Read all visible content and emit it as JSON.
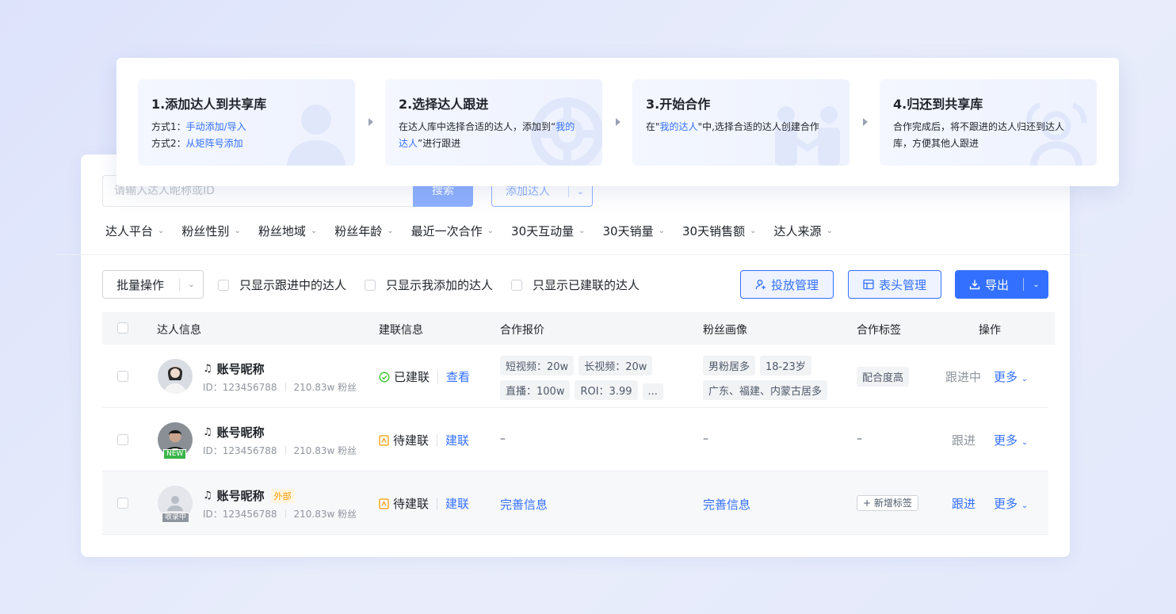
{
  "steps": [
    {
      "title": "1.添加达人到共享库",
      "line1_prefix": "方式1：",
      "line1_link": "手动添加/导入",
      "line2_prefix": "方式2：",
      "line2_link": "从矩阵号添加"
    },
    {
      "title": "2.选择达人跟进",
      "desc_a": "在达人库中选择合适的达人，添加到“",
      "desc_link": "我的达人",
      "desc_b": "”进行跟进"
    },
    {
      "title": "3.开始合作",
      "desc_a": "在\"",
      "desc_link": "我的达人",
      "desc_b": "\"中,选择合适的达人创建合作"
    },
    {
      "title": "4.归还到共享库",
      "desc": "合作完成后，将不跟进的达人归还到达人库，方便其他人跟进"
    }
  ],
  "search": {
    "placeholder": "请输入达人昵称或ID",
    "button": "搜索",
    "add_button": "添加达人"
  },
  "filters": [
    "达人平台",
    "粉丝性别",
    "粉丝地域",
    "粉丝年龄",
    "最近一次合作",
    "30天互动量",
    "30天销量",
    "30天销售额",
    "达人来源"
  ],
  "toolbar": {
    "batch": "批量操作",
    "check_following": "只显示跟进中的达人",
    "check_mine": "只显示我添加的达人",
    "check_linked": "只显示已建联的达人",
    "ad_manage": "投放管理",
    "header_manage": "表头管理",
    "export": "导出"
  },
  "columns": [
    "达人信息",
    "建联信息",
    "合作报价",
    "粉丝画像",
    "合作标签",
    "操作"
  ],
  "rows": [
    {
      "name": "账号昵称",
      "id": "ID：123456788",
      "fans": "210.83w 粉丝",
      "status": "已建联",
      "status_link": "查看",
      "quotes": [
        "短视频：20w",
        "长视频：20w",
        "直播：100w",
        "ROI：3.99",
        "..."
      ],
      "portrait": [
        "男粉居多",
        "18-23岁",
        "广东、福建、内蒙古居多"
      ],
      "tag": "配合度高",
      "action": "跟进中",
      "more": "更多"
    },
    {
      "name": "账号昵称",
      "id": "ID：123456788",
      "fans": "210.83w 粉丝",
      "badge": "NEW",
      "status": "待建联",
      "status_link": "建联",
      "quote_empty": "–",
      "portrait_empty": "–",
      "tag_empty": "–",
      "action": "跟进",
      "more": "更多"
    },
    {
      "name": "账号昵称",
      "external": "外部",
      "id": "ID：123456788",
      "fans": "210.83w 粉丝",
      "badge": "收录中",
      "status": "待建联",
      "status_link": "建联",
      "quote_link": "完善信息",
      "portrait_link": "完善信息",
      "tag_button": "新增标签",
      "action": "跟进",
      "more": "更多"
    }
  ],
  "colors": {
    "primary": "#3370ff",
    "success": "#34c724",
    "warning": "#ff9a00"
  }
}
